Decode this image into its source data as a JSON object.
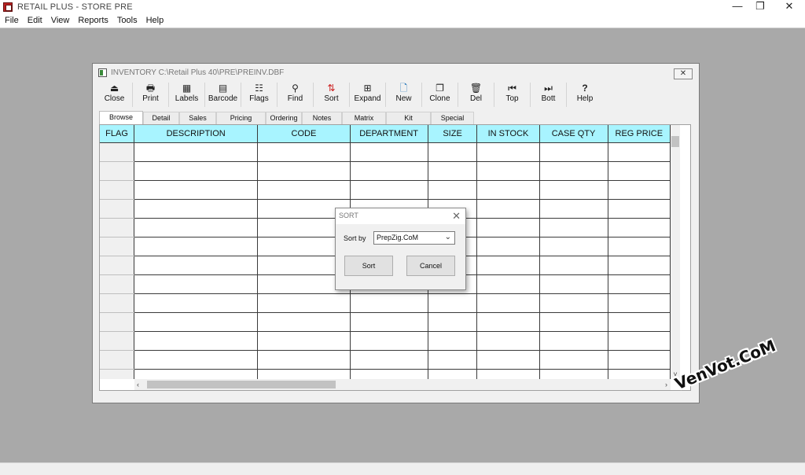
{
  "app": {
    "title": "RETAIL PLUS  -  STORE PRE",
    "controls": {
      "minimize": "—",
      "maximize": "❐",
      "close": "✕"
    }
  },
  "menu": [
    "File",
    "Edit",
    "View",
    "Reports",
    "Tools",
    "Help"
  ],
  "inventory_window": {
    "title": "INVENTORY C:\\Retail Plus 40\\PRE\\PREINV.DBF",
    "close_label": "✕",
    "toolbar": [
      {
        "label": "Close",
        "icon": "⏏"
      },
      {
        "label": "Print",
        "icon": "🖶"
      },
      {
        "label": "Labels",
        "icon": "▦"
      },
      {
        "label": "Barcode",
        "icon": "▤"
      },
      {
        "label": "Flags",
        "icon": "☷"
      },
      {
        "label": "Find",
        "icon": "⚲"
      },
      {
        "label": "Sort",
        "icon": "⇅"
      },
      {
        "label": "Expand",
        "icon": "⊞"
      },
      {
        "label": "New",
        "icon": "🗋"
      },
      {
        "label": "Clone",
        "icon": "❐"
      },
      {
        "label": "Del",
        "icon": "🗑"
      },
      {
        "label": "Top",
        "icon": "⏮"
      },
      {
        "label": "Bott",
        "icon": "⏭"
      },
      {
        "label": "Help",
        "icon": "?"
      }
    ],
    "tabs": [
      "Browse",
      "Detail",
      "Sales",
      "Pricing",
      "Ordering",
      "Notes",
      "Matrix",
      "Kit",
      "Special"
    ],
    "active_tab": "Browse",
    "columns": [
      "FLAG",
      "DESCRIPTION",
      "CODE",
      "DEPARTMENT",
      "SIZE",
      "IN STOCK",
      "CASE QTY",
      "REG PRICE"
    ],
    "scroll": {
      "up": "▲",
      "down": "˅",
      "left": "‹",
      "right": "›"
    }
  },
  "sort_dialog": {
    "title": "SORT",
    "close_label": "✕",
    "sort_by_label": "Sort by",
    "sort_by_value": "PrepZig.CoM",
    "chevron": "⌄",
    "sort_button": "Sort",
    "cancel_button": "Cancel"
  },
  "watermark": "VenVot.CoM",
  "colors": {
    "header_bg": "#a8f4ff",
    "workspace_bg": "#a9a9a9"
  }
}
